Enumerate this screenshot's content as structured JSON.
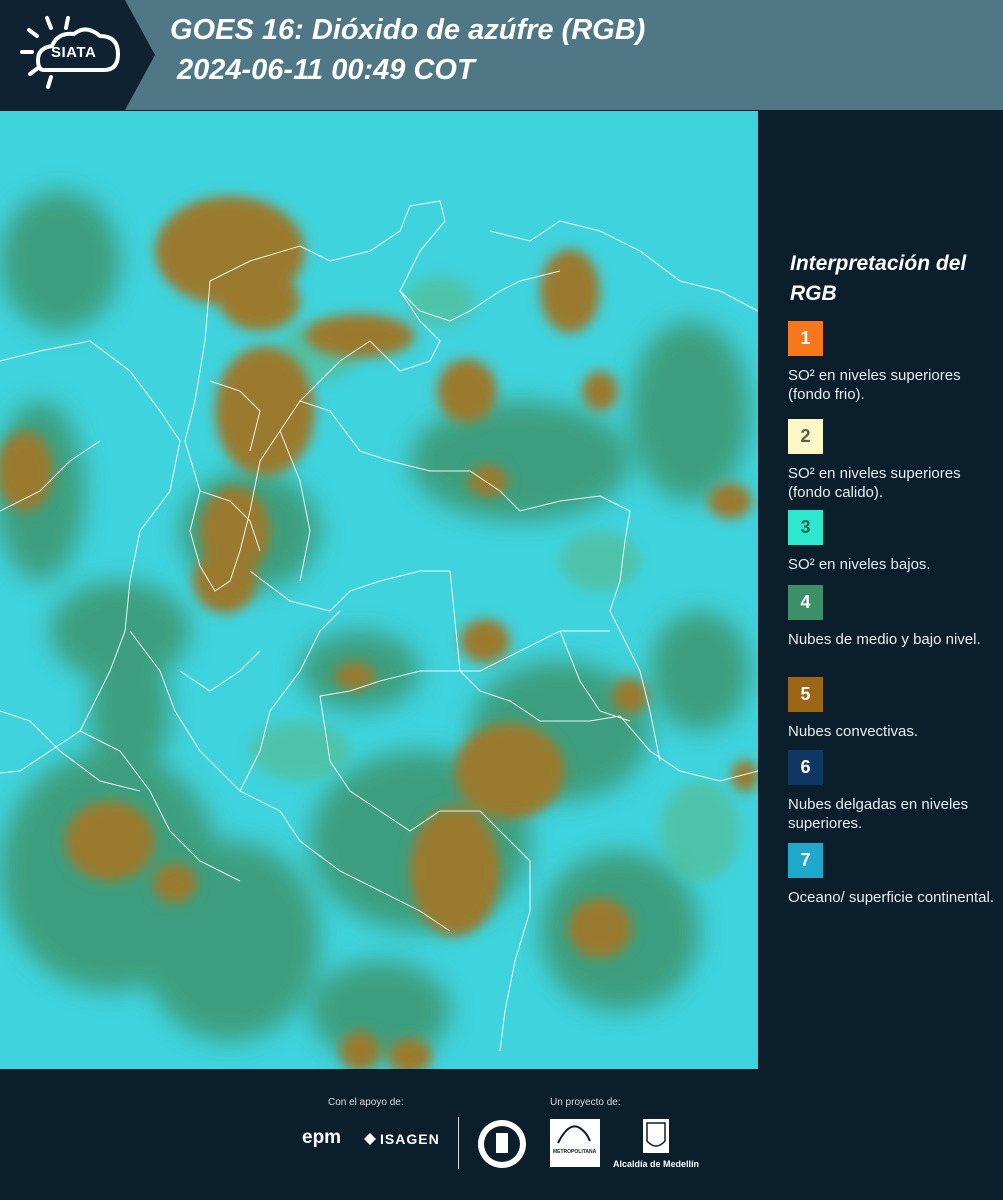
{
  "header": {
    "logo_text": "SIATA",
    "title_line1": "GOES 16: Dióxido de azúfre (RGB)",
    "title_line2": "2024-06-11 00:49 COT"
  },
  "legend": {
    "title": "Interpretación del RGB",
    "items": [
      {
        "number": "1",
        "label": "SO² en niveles superiores (fondo frio).",
        "color": "#f5781d",
        "text_color": "#ffffff"
      },
      {
        "number": "2",
        "label": "SO² en niveles superiores (fondo calido).",
        "color": "#fdf8c5",
        "text_color": "#5a5a5a"
      },
      {
        "number": "3",
        "label": "SO² en niveles bajos.",
        "color": "#2de8cd",
        "text_color": "#1a6a62"
      },
      {
        "number": "4",
        "label": "Nubes de medio y bajo nivel.",
        "color": "#3c9068",
        "text_color": "#ffffff"
      },
      {
        "number": "5",
        "label": "Nubes convectivas.",
        "color": "#9c6617",
        "text_color": "#ffffff"
      },
      {
        "number": "6",
        "label": "Nubes delgadas en niveles superiores.",
        "color": "#0e3763",
        "text_color": "#ffffff"
      },
      {
        "number": "7",
        "label": "Oceano/ superficie continental.",
        "color": "#1ea8cc",
        "text_color": "#ffffff"
      }
    ]
  },
  "footer": {
    "support_label": "Con el apoyo de:",
    "project_label": "Un proyecto de:",
    "epm": "epm",
    "isagen": "ISAGEN",
    "metro_text": "METROPOLITANA",
    "alcaldia": "Alcaldía de Medellín"
  },
  "colors": {
    "header_bg": "#4f7785",
    "panel_bg": "#0b1e2c",
    "map_cyan": "#3fd3dd",
    "map_green": "#3e9a74",
    "map_brown": "#9a7a2e"
  }
}
